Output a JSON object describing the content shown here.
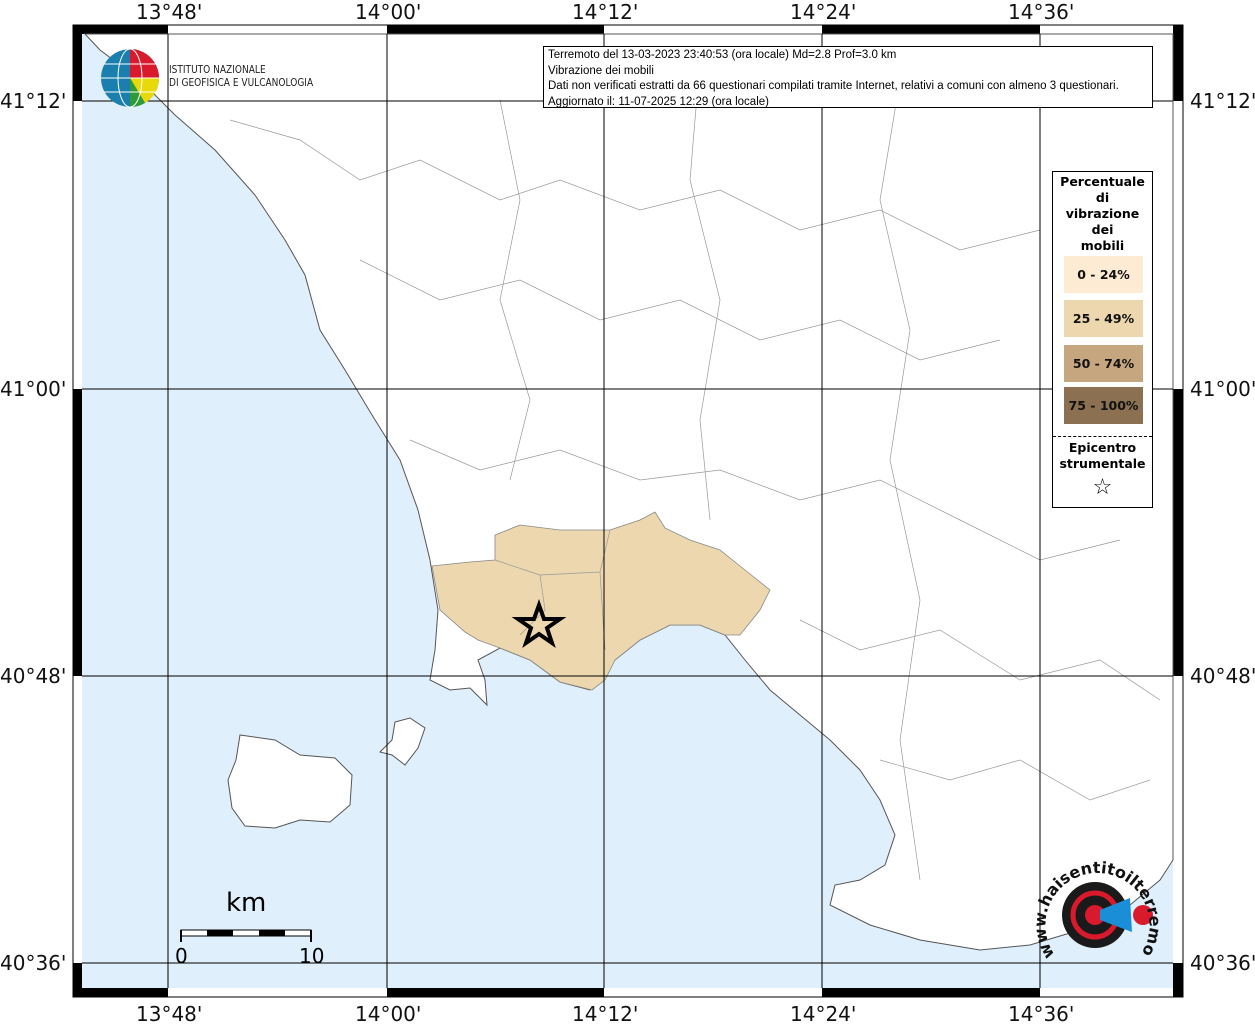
{
  "info": {
    "line1": "Terremoto del 13-03-2023 23:40:53 (ora locale) Md=2.8 Prof=3.0 km",
    "line2": "Vibrazione dei mobili",
    "line3": "Dati non verificati estratti da 66 questionari compilati tramite Internet, relativi a comuni con almeno 3 questionari.",
    "line4": "Aggiornato il: 11-07-2025 12:29 (ora locale)"
  },
  "axes": {
    "lon_ticks": [
      "13°48'",
      "14°00'",
      "14°12'",
      "14°24'",
      "14°36'"
    ],
    "lat_ticks": [
      "41°12'",
      "41°00'",
      "40°48'",
      "40°36'"
    ]
  },
  "legend": {
    "title_lines": [
      "Percentuale",
      "di",
      "vibrazione",
      "dei",
      "mobili"
    ],
    "classes": [
      {
        "label": "0 - 24%",
        "color": "#fdebd3"
      },
      {
        "label": "25 - 49%",
        "color": "#ecd7ae"
      },
      {
        "label": "50 - 74%",
        "color": "#c5a67e"
      },
      {
        "label": "75 - 100%",
        "color": "#8b7152"
      }
    ],
    "epicenter_lines": [
      "Epicentro",
      "strumentale"
    ]
  },
  "logos": {
    "ingv_line1": "ISTITUTO NAZIONALE",
    "ingv_line2": "DI GEOFISICA E VULCANOLOGIA",
    "hsit": "www.haisentitoilterremoto.it"
  },
  "scale": {
    "unit": "km",
    "start": "0",
    "end": "10"
  },
  "colors": {
    "sea": "#dff0fc",
    "land": "#ffffff",
    "affected": "#ecd7ae"
  }
}
